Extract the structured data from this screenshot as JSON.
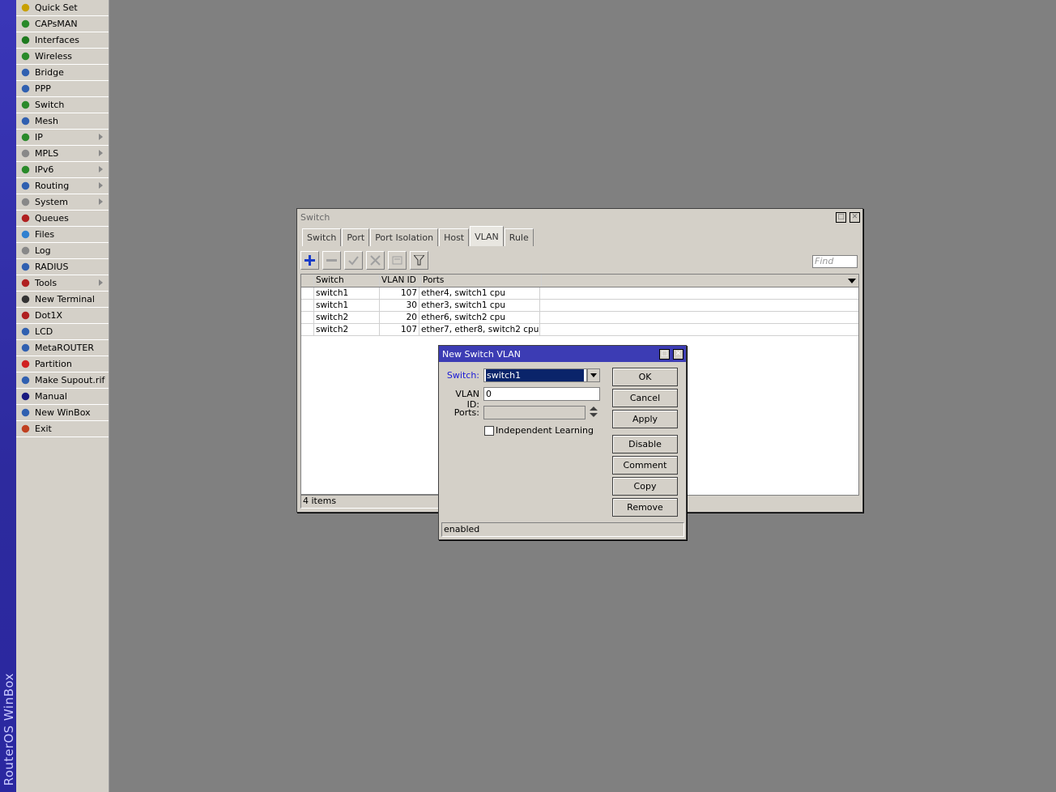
{
  "app": {
    "sidebar_title": "RouterOS WinBox"
  },
  "sidebar": {
    "items": [
      {
        "label": "Quick Set",
        "icon": "wand-icon",
        "sub": false
      },
      {
        "label": "CAPsMAN",
        "icon": "antenna-icon",
        "sub": false
      },
      {
        "label": "Interfaces",
        "icon": "interfaces-icon",
        "sub": false
      },
      {
        "label": "Wireless",
        "icon": "wireless-icon",
        "sub": false
      },
      {
        "label": "Bridge",
        "icon": "bridge-icon",
        "sub": false
      },
      {
        "label": "PPP",
        "icon": "ppp-icon",
        "sub": false
      },
      {
        "label": "Switch",
        "icon": "switch-icon",
        "sub": false
      },
      {
        "label": "Mesh",
        "icon": "mesh-icon",
        "sub": false
      },
      {
        "label": "IP",
        "icon": "ip-icon",
        "sub": true
      },
      {
        "label": "MPLS",
        "icon": "mpls-icon",
        "sub": true
      },
      {
        "label": "IPv6",
        "icon": "ipv6-icon",
        "sub": true
      },
      {
        "label": "Routing",
        "icon": "routing-icon",
        "sub": true
      },
      {
        "label": "System",
        "icon": "system-icon",
        "sub": true
      },
      {
        "label": "Queues",
        "icon": "queues-icon",
        "sub": false
      },
      {
        "label": "Files",
        "icon": "files-icon",
        "sub": false
      },
      {
        "label": "Log",
        "icon": "log-icon",
        "sub": false
      },
      {
        "label": "RADIUS",
        "icon": "radius-icon",
        "sub": false
      },
      {
        "label": "Tools",
        "icon": "tools-icon",
        "sub": true
      },
      {
        "label": "New Terminal",
        "icon": "terminal-icon",
        "sub": false
      },
      {
        "label": "Dot1X",
        "icon": "dot1x-icon",
        "sub": false
      },
      {
        "label": "LCD",
        "icon": "lcd-icon",
        "sub": false
      },
      {
        "label": "MetaROUTER",
        "icon": "metarouter-icon",
        "sub": false
      },
      {
        "label": "Partition",
        "icon": "partition-icon",
        "sub": false
      },
      {
        "label": "Make Supout.rif",
        "icon": "supout-icon",
        "sub": false
      },
      {
        "label": "Manual",
        "icon": "manual-icon",
        "sub": false
      },
      {
        "label": "New WinBox",
        "icon": "winbox-icon",
        "sub": false
      },
      {
        "label": "Exit",
        "icon": "exit-icon",
        "sub": false
      }
    ]
  },
  "switch_window": {
    "title": "Switch",
    "tabs": [
      "Switch",
      "Port",
      "Port Isolation",
      "Host",
      "VLAN",
      "Rule"
    ],
    "selected_tab": "VLAN",
    "find_placeholder": "Find",
    "columns": [
      "Switch",
      "VLAN ID",
      "Ports"
    ],
    "rows": [
      {
        "switch": "switch1",
        "vlan_id": "107",
        "ports": "ether4, switch1 cpu"
      },
      {
        "switch": "switch1",
        "vlan_id": "30",
        "ports": "ether3, switch1 cpu"
      },
      {
        "switch": "switch2",
        "vlan_id": "20",
        "ports": "ether6, switch2 cpu"
      },
      {
        "switch": "switch2",
        "vlan_id": "107",
        "ports": "ether7, ether8, switch2 cpu"
      }
    ],
    "status": "4 items"
  },
  "dialog": {
    "title": "New Switch VLAN",
    "switch_label": "Switch:",
    "switch_value": "switch1",
    "vlan_label": "VLAN ID:",
    "vlan_value": "0",
    "ports_label": "Ports:",
    "independent_label": "Independent Learning",
    "independent_checked": false,
    "buttons": {
      "ok": "OK",
      "cancel": "Cancel",
      "apply": "Apply",
      "disable": "Disable",
      "comment": "Comment",
      "copy": "Copy",
      "remove": "Remove"
    },
    "status": "enabled"
  },
  "colors": {
    "accent": "#3c3cb4",
    "desktop": "#808080"
  }
}
